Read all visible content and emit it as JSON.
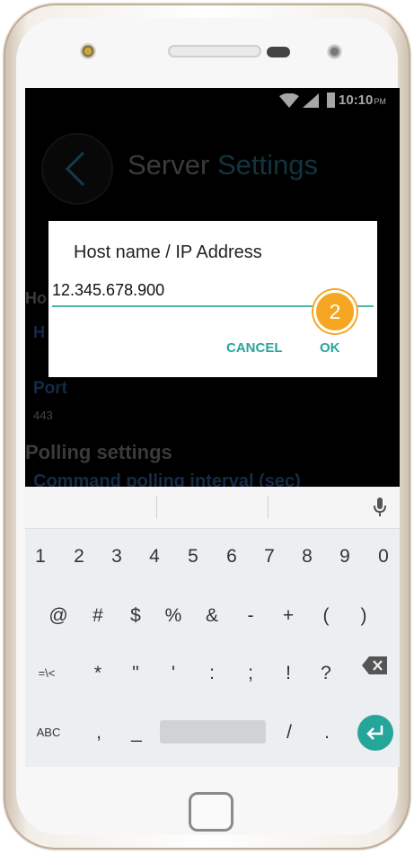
{
  "status": {
    "time": "10:10",
    "ampm": "PM"
  },
  "app": {
    "title_part1": "Server",
    "title_part2": "Settings"
  },
  "background": {
    "host_header": "Ho",
    "host_value": "H",
    "port_label": "Port",
    "port_value": "443",
    "polling_title": "Polling settings",
    "polling_item": "Command polling interval (sec)"
  },
  "dialog": {
    "title": "Host name / IP Address",
    "input_value": "12.345.678.900",
    "badge": "2",
    "cancel": "CANCEL",
    "ok": "OK"
  },
  "keyboard": {
    "row1": [
      "1",
      "2",
      "3",
      "4",
      "5",
      "6",
      "7",
      "8",
      "9",
      "0"
    ],
    "row2": [
      "@",
      "#",
      "$",
      "%",
      "&",
      "-",
      "+",
      "(",
      ")"
    ],
    "row3": [
      "=\\<",
      "*",
      "\"",
      "'",
      ":",
      ";",
      "!",
      "?"
    ],
    "row4": {
      "abc": "ABC",
      "comma": ",",
      "underscore": "_",
      "slash": "/",
      "period": "."
    }
  },
  "colors": {
    "accent": "#26a69a",
    "badge": "#f5a623",
    "underline": "#4db6ac"
  },
  "icons": [
    "back-arrow-icon",
    "wifi-icon",
    "signal-icon",
    "battery-icon",
    "mic-icon",
    "backspace-icon",
    "enter-icon"
  ]
}
